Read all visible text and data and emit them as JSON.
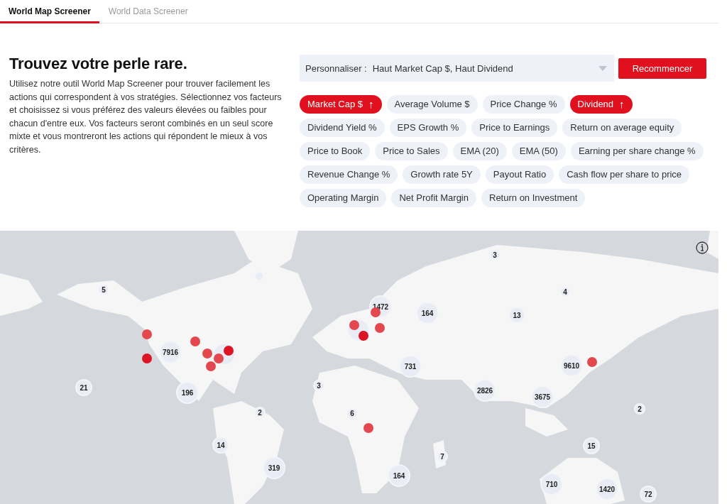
{
  "tabs": [
    {
      "label": "World Map Screener",
      "selected": true
    },
    {
      "label": "World Data Screener",
      "selected": false
    }
  ],
  "intro": {
    "title": "Trouvez votre perle rare.",
    "text": "Utilisez notre outil World Map Screener pour trouver facilement les actions qui correspondent à vos stratégies. Sélectionnez vos facteurs et choisissez si vous préférez des valeurs élevées ou faibles pour chacun d'entre eux. Vos facteurs seront combinés en un seul score mixte et vous montreront les actions qui répondent le mieux à vos critères."
  },
  "customize": {
    "label": "Personnaliser :",
    "value": "Haut Market Cap $, Haut Dividend"
  },
  "reset_button": "Recommencer",
  "factors": [
    {
      "label": "Market Cap $",
      "selected": true,
      "arrow": "↑"
    },
    {
      "label": "Average Volume $",
      "selected": false
    },
    {
      "label": "Price Change %",
      "selected": false
    },
    {
      "label": "Dividend",
      "selected": true,
      "arrow": "↑"
    },
    {
      "label": "Dividend Yield %",
      "selected": false
    },
    {
      "label": "EPS Growth %",
      "selected": false
    },
    {
      "label": "Price to Earnings",
      "selected": false
    },
    {
      "label": "Return on average equity",
      "selected": false
    },
    {
      "label": "Price to Book",
      "selected": false
    },
    {
      "label": "Price to Sales",
      "selected": false
    },
    {
      "label": "EMA (20)",
      "selected": false
    },
    {
      "label": "EMA (50)",
      "selected": false
    },
    {
      "label": "Earning per share change %",
      "selected": false
    },
    {
      "label": "Revenue Change %",
      "selected": false
    },
    {
      "label": "Growth rate 5Y",
      "selected": false
    },
    {
      "label": "Payout Ratio",
      "selected": false
    },
    {
      "label": "Cash flow per share to price",
      "selected": false
    },
    {
      "label": "Operating Margin",
      "selected": false
    },
    {
      "label": "Net Profit Margin",
      "selected": false
    },
    {
      "label": "Return on Investment",
      "selected": false
    }
  ],
  "map": {
    "kind": "picture",
    "clusters": [
      {
        "kind": "count",
        "count": "3"
      },
      {
        "kind": "count",
        "count": "5"
      },
      {
        "kind": "count",
        "count": "4"
      },
      {
        "kind": "count",
        "count": "1472"
      },
      {
        "kind": "count",
        "count": "164"
      },
      {
        "kind": "count",
        "count": "13"
      },
      {
        "kind": "blank"
      },
      {
        "kind": "blank"
      },
      {
        "kind": "count",
        "count": "7916"
      },
      {
        "kind": "blank"
      },
      {
        "kind": "count",
        "count": "731"
      },
      {
        "kind": "count",
        "count": "9610"
      },
      {
        "kind": "count",
        "count": "21"
      },
      {
        "kind": "count",
        "count": "3"
      },
      {
        "kind": "count",
        "count": "196"
      },
      {
        "kind": "count",
        "count": "2826"
      },
      {
        "kind": "count",
        "count": "3675"
      },
      {
        "kind": "count",
        "count": "2"
      },
      {
        "kind": "count",
        "count": "6"
      },
      {
        "kind": "count",
        "count": "2"
      },
      {
        "kind": "count",
        "count": "14"
      },
      {
        "kind": "count",
        "count": "15"
      },
      {
        "kind": "count",
        "count": "7"
      },
      {
        "kind": "count",
        "count": "319"
      },
      {
        "kind": "count",
        "count": "164"
      },
      {
        "kind": "count",
        "count": "710"
      },
      {
        "kind": "count",
        "count": "1420"
      },
      {
        "kind": "count",
        "count": "72"
      }
    ],
    "markers": [
      {
        "color": "#e4484f"
      },
      {
        "color": "#dc1424"
      },
      {
        "color": "#e4484f"
      },
      {
        "color": "#e4484f"
      },
      {
        "color": "#e4484f"
      },
      {
        "color": "#e4484f"
      },
      {
        "color": "#dc1424"
      },
      {
        "color": "#e4484f"
      },
      {
        "color": "#e4484f"
      },
      {
        "color": "#e4484f"
      },
      {
        "color": "#dc1424"
      },
      {
        "color": "#e4484f"
      },
      {
        "color": "#e4484f"
      }
    ]
  }
}
